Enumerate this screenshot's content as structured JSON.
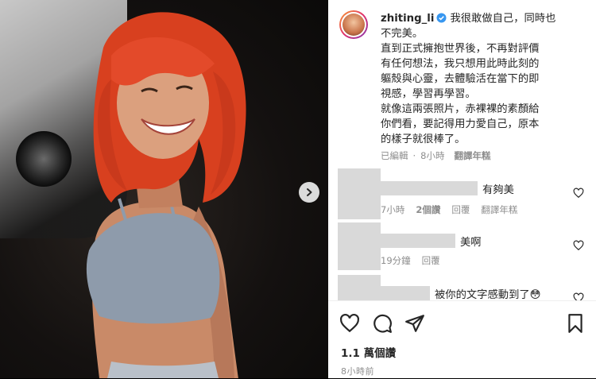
{
  "post": {
    "username": "zhiting_li",
    "caption": "我很敢做自己，同時也\n不完美。\n直到正式擁抱世界後，不再對評價\n有任何想法，我只想用此時此刻的\n軀殼與心靈，去體驗活在當下的即\n視感，學習再學習。\n就像這兩張照片，赤裸裸的素顏給\n你們看，要記得用力愛自己，原本\n的樣子就很棒了。",
    "edited_label": "已編輯",
    "time_ago": "8小時",
    "translate_label": "翻譯年糕"
  },
  "comments": [
    {
      "text": "有夠美",
      "time": "7小時",
      "likes": "2個讚",
      "reply": "回覆",
      "translate": "翻譯年糕"
    },
    {
      "text": "美啊",
      "time": "19分鐘",
      "reply": "回覆"
    },
    {
      "text": "被你的文字感動到了😳"
    }
  ],
  "actions": {
    "like_icon": "heart-icon",
    "comment_icon": "comment-icon",
    "share_icon": "share-icon",
    "save_icon": "bookmark-icon"
  },
  "stats": {
    "views": "1.1 萬個讚",
    "posted_ago": "8小時前"
  },
  "colors": {
    "verified": "#3897f0",
    "hair": "#e0452c",
    "top": "#8e9bab"
  }
}
